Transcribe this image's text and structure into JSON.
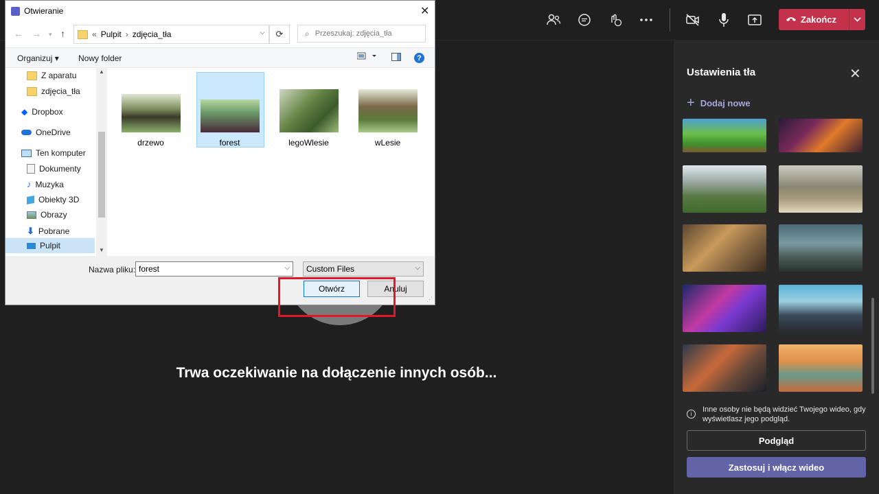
{
  "top_bar": {
    "icons": [
      "participants-icon",
      "chat-icon",
      "reactions-icon",
      "more-icon",
      "camera-off-icon",
      "mic-icon",
      "share-icon"
    ],
    "end_call": {
      "label": "Zakończ"
    }
  },
  "stage": {
    "waiting_text": "Trwa oczekiwanie na dołączenie innych osób..."
  },
  "panel": {
    "title": "Ustawienia tła",
    "add_new": "Dodaj nowe",
    "info": "Inne osoby nie będą widzieć Twojego wideo, gdy wyświetlasz jego podgląd.",
    "preview_button": "Podgląd",
    "apply_button": "Zastosuj i włącz wideo"
  },
  "dialog": {
    "title": "Otwieranie",
    "address": {
      "prefix": "«",
      "crumbs": [
        "Pulpit",
        "zdjęcia_tła"
      ]
    },
    "search_placeholder": "Przeszukaj: zdjęcia_tła",
    "organize": "Organizuj",
    "new_folder": "Nowy folder",
    "tree": [
      {
        "label": "Z aparatu",
        "icon": "folder-icon"
      },
      {
        "label": "zdjęcia_tła",
        "icon": "folder-icon"
      },
      {
        "label": "Dropbox",
        "icon": "dropbox-icon"
      },
      {
        "label": "OneDrive",
        "icon": "onedrive-icon"
      },
      {
        "label": "Ten komputer",
        "icon": "computer-icon"
      },
      {
        "label": "Dokumenty",
        "icon": "documents-icon"
      },
      {
        "label": "Muzyka",
        "icon": "music-icon"
      },
      {
        "label": "Obiekty 3D",
        "icon": "objects-3d-icon"
      },
      {
        "label": "Obrazy",
        "icon": "pictures-icon"
      },
      {
        "label": "Pobrane",
        "icon": "downloads-icon"
      },
      {
        "label": "Pulpit",
        "icon": "desktop-icon",
        "selected": true
      }
    ],
    "files": [
      {
        "name": "drzewo"
      },
      {
        "name": "forest",
        "selected": true
      },
      {
        "name": "legoWlesie"
      },
      {
        "name": "wLesie"
      }
    ],
    "filename_label": "Nazwa pliku:",
    "filename_value": "forest",
    "filetype": "Custom Files",
    "open_button": "Otwórz",
    "cancel_button": "Anuluj"
  },
  "colors": {
    "end_call": "#c4314b",
    "accent": "#6264a7",
    "highlight": "#e0182c",
    "selection": "#cce8ff"
  }
}
